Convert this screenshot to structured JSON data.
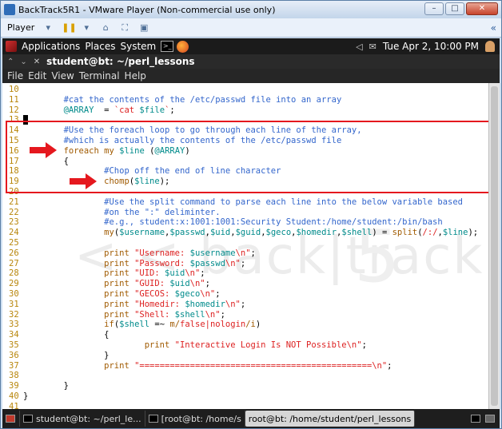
{
  "vm": {
    "title": "BackTrack5R1 - VMware Player (Non-commercial use only)",
    "player_label": "Player",
    "buttons": [
      "minimize",
      "maximize",
      "close"
    ]
  },
  "panel": {
    "applications": "Applications",
    "places": "Places",
    "system": "System",
    "clock": "Tue Apr  2, 10:00 PM"
  },
  "terminal": {
    "title": "student@bt: ~/perl_lessons",
    "menu": [
      "File",
      "Edit",
      "View",
      "Terminal",
      "Help"
    ]
  },
  "code": {
    "lines": [
      {
        "n": "10",
        "tokens": []
      },
      {
        "n": "11",
        "tokens": [
          {
            "t": "        ",
            "c": "plain"
          },
          {
            "t": "#cat the contents of the /etc/passwd file into an array",
            "c": "comment"
          }
        ]
      },
      {
        "n": "12",
        "tokens": [
          {
            "t": "        ",
            "c": "plain"
          },
          {
            "t": "@ARRAY",
            "c": "var"
          },
          {
            "t": "  = ",
            "c": "plain"
          },
          {
            "t": "`cat ",
            "c": "str"
          },
          {
            "t": "$file",
            "c": "var"
          },
          {
            "t": "`",
            "c": "str"
          },
          {
            "t": ";",
            "c": "plain"
          }
        ]
      },
      {
        "n": "13",
        "tokens": [
          {
            "t": " ",
            "c": "cursor"
          }
        ]
      },
      {
        "n": "14",
        "tokens": [
          {
            "t": "        ",
            "c": "plain"
          },
          {
            "t": "#Use the foreach loop to go through each line of the array,",
            "c": "comment"
          }
        ]
      },
      {
        "n": "15",
        "tokens": [
          {
            "t": "        ",
            "c": "plain"
          },
          {
            "t": "#which is actually the contents of the /etc/passwd file",
            "c": "comment"
          }
        ]
      },
      {
        "n": "16",
        "tokens": [
          {
            "t": "        ",
            "c": "plain"
          },
          {
            "t": "foreach",
            "c": "kw"
          },
          {
            "t": " ",
            "c": "plain"
          },
          {
            "t": "my",
            "c": "kw"
          },
          {
            "t": " ",
            "c": "plain"
          },
          {
            "t": "$line",
            "c": "var"
          },
          {
            "t": " (",
            "c": "plain"
          },
          {
            "t": "@ARRAY",
            "c": "var"
          },
          {
            "t": ")",
            "c": "plain"
          }
        ]
      },
      {
        "n": "17",
        "tokens": [
          {
            "t": "        {",
            "c": "plain"
          }
        ]
      },
      {
        "n": "18",
        "tokens": [
          {
            "t": "                ",
            "c": "plain"
          },
          {
            "t": "#Chop off the end of line character",
            "c": "comment"
          }
        ]
      },
      {
        "n": "19",
        "tokens": [
          {
            "t": "                ",
            "c": "plain"
          },
          {
            "t": "chomp",
            "c": "kw"
          },
          {
            "t": "(",
            "c": "plain"
          },
          {
            "t": "$line",
            "c": "var"
          },
          {
            "t": ");",
            "c": "plain"
          }
        ]
      },
      {
        "n": "20",
        "tokens": []
      },
      {
        "n": "21",
        "tokens": [
          {
            "t": "                ",
            "c": "plain"
          },
          {
            "t": "#Use the split command to parse each line into the below variable based",
            "c": "comment"
          }
        ]
      },
      {
        "n": "22",
        "tokens": [
          {
            "t": "                ",
            "c": "plain"
          },
          {
            "t": "#on the \":\" deliminter.",
            "c": "comment"
          }
        ]
      },
      {
        "n": "23",
        "tokens": [
          {
            "t": "                ",
            "c": "plain"
          },
          {
            "t": "#e.g., student:x:1001:1001:Security Student:/home/student:/bin/bash",
            "c": "comment"
          }
        ]
      },
      {
        "n": "24",
        "tokens": [
          {
            "t": "                ",
            "c": "plain"
          },
          {
            "t": "my",
            "c": "kw"
          },
          {
            "t": "(",
            "c": "plain"
          },
          {
            "t": "$username",
            "c": "var"
          },
          {
            "t": ",",
            "c": "plain"
          },
          {
            "t": "$passwd",
            "c": "var"
          },
          {
            "t": ",",
            "c": "plain"
          },
          {
            "t": "$uid",
            "c": "var"
          },
          {
            "t": ",",
            "c": "plain"
          },
          {
            "t": "$guid",
            "c": "var"
          },
          {
            "t": ",",
            "c": "plain"
          },
          {
            "t": "$geco",
            "c": "var"
          },
          {
            "t": ",",
            "c": "plain"
          },
          {
            "t": "$homedir",
            "c": "var"
          },
          {
            "t": ",",
            "c": "plain"
          },
          {
            "t": "$shell",
            "c": "var"
          },
          {
            "t": ") = ",
            "c": "plain"
          },
          {
            "t": "split",
            "c": "kw"
          },
          {
            "t": "(",
            "c": "plain"
          },
          {
            "t": "/:/",
            "c": "str"
          },
          {
            "t": ",",
            "c": "plain"
          },
          {
            "t": "$line",
            "c": "var"
          },
          {
            "t": ");",
            "c": "plain"
          }
        ]
      },
      {
        "n": "25",
        "tokens": []
      },
      {
        "n": "26",
        "tokens": [
          {
            "t": "                ",
            "c": "plain"
          },
          {
            "t": "print",
            "c": "kw"
          },
          {
            "t": " ",
            "c": "plain"
          },
          {
            "t": "\"Username: ",
            "c": "str"
          },
          {
            "t": "$username",
            "c": "var"
          },
          {
            "t": "\\n\"",
            "c": "str"
          },
          {
            "t": ";",
            "c": "plain"
          }
        ]
      },
      {
        "n": "27",
        "tokens": [
          {
            "t": "                ",
            "c": "plain"
          },
          {
            "t": "print",
            "c": "kw"
          },
          {
            "t": " ",
            "c": "plain"
          },
          {
            "t": "\"Password: ",
            "c": "str"
          },
          {
            "t": "$passwd",
            "c": "var"
          },
          {
            "t": "\\n\"",
            "c": "str"
          },
          {
            "t": ";",
            "c": "plain"
          }
        ]
      },
      {
        "n": "28",
        "tokens": [
          {
            "t": "                ",
            "c": "plain"
          },
          {
            "t": "print",
            "c": "kw"
          },
          {
            "t": " ",
            "c": "plain"
          },
          {
            "t": "\"UID: ",
            "c": "str"
          },
          {
            "t": "$uid",
            "c": "var"
          },
          {
            "t": "\\n\"",
            "c": "str"
          },
          {
            "t": ";",
            "c": "plain"
          }
        ]
      },
      {
        "n": "29",
        "tokens": [
          {
            "t": "                ",
            "c": "plain"
          },
          {
            "t": "print",
            "c": "kw"
          },
          {
            "t": " ",
            "c": "plain"
          },
          {
            "t": "\"GUID: ",
            "c": "str"
          },
          {
            "t": "$uid",
            "c": "var"
          },
          {
            "t": "\\n\"",
            "c": "str"
          },
          {
            "t": ";",
            "c": "plain"
          }
        ]
      },
      {
        "n": "30",
        "tokens": [
          {
            "t": "                ",
            "c": "plain"
          },
          {
            "t": "print",
            "c": "kw"
          },
          {
            "t": " ",
            "c": "plain"
          },
          {
            "t": "\"GECOS: ",
            "c": "str"
          },
          {
            "t": "$geco",
            "c": "var"
          },
          {
            "t": "\\n\"",
            "c": "str"
          },
          {
            "t": ";",
            "c": "plain"
          }
        ]
      },
      {
        "n": "31",
        "tokens": [
          {
            "t": "                ",
            "c": "plain"
          },
          {
            "t": "print",
            "c": "kw"
          },
          {
            "t": " ",
            "c": "plain"
          },
          {
            "t": "\"Homedir: ",
            "c": "str"
          },
          {
            "t": "$homedir",
            "c": "var"
          },
          {
            "t": "\\n\"",
            "c": "str"
          },
          {
            "t": ";",
            "c": "plain"
          }
        ]
      },
      {
        "n": "32",
        "tokens": [
          {
            "t": "                ",
            "c": "plain"
          },
          {
            "t": "print",
            "c": "kw"
          },
          {
            "t": " ",
            "c": "plain"
          },
          {
            "t": "\"Shell: ",
            "c": "str"
          },
          {
            "t": "$shell",
            "c": "var"
          },
          {
            "t": "\\n\"",
            "c": "str"
          },
          {
            "t": ";",
            "c": "plain"
          }
        ]
      },
      {
        "n": "33",
        "tokens": [
          {
            "t": "                ",
            "c": "plain"
          },
          {
            "t": "if",
            "c": "kw"
          },
          {
            "t": "(",
            "c": "plain"
          },
          {
            "t": "$shell",
            "c": "var"
          },
          {
            "t": " =~ ",
            "c": "plain"
          },
          {
            "t": "m/",
            "c": "kw"
          },
          {
            "t": "false|nologin",
            "c": "str"
          },
          {
            "t": "/i",
            "c": "kw"
          },
          {
            "t": ")",
            "c": "plain"
          }
        ]
      },
      {
        "n": "34",
        "tokens": [
          {
            "t": "                {",
            "c": "plain"
          }
        ]
      },
      {
        "n": "35",
        "tokens": [
          {
            "t": "                        ",
            "c": "plain"
          },
          {
            "t": "print",
            "c": "kw"
          },
          {
            "t": " ",
            "c": "plain"
          },
          {
            "t": "\"Interactive Login Is NOT Possible",
            "c": "str"
          },
          {
            "t": "\\n\"",
            "c": "str"
          },
          {
            "t": ";",
            "c": "plain"
          }
        ]
      },
      {
        "n": "36",
        "tokens": [
          {
            "t": "                }",
            "c": "plain"
          }
        ]
      },
      {
        "n": "37",
        "tokens": [
          {
            "t": "                ",
            "c": "plain"
          },
          {
            "t": "print",
            "c": "kw"
          },
          {
            "t": " ",
            "c": "plain"
          },
          {
            "t": "\"==============================================\\n\"",
            "c": "str"
          },
          {
            "t": ";",
            "c": "plain"
          }
        ]
      },
      {
        "n": "38",
        "tokens": []
      },
      {
        "n": "39",
        "tokens": [
          {
            "t": "        }",
            "c": "plain"
          }
        ]
      },
      {
        "n": "40",
        "tokens": [
          {
            "t": "}",
            "c": "plain"
          }
        ]
      },
      {
        "n": "41",
        "tokens": []
      }
    ]
  },
  "taskbar": {
    "items": [
      {
        "label": "student@bt: ~/perl_le...",
        "active": false
      },
      {
        "label": "[root@bt: /home/s",
        "active": false
      },
      {
        "label": "root@bt: /home/student/perl_lessons",
        "active": true
      }
    ]
  },
  "colors": {
    "highlight": "#e5181e",
    "arrow": "#e5181e"
  }
}
